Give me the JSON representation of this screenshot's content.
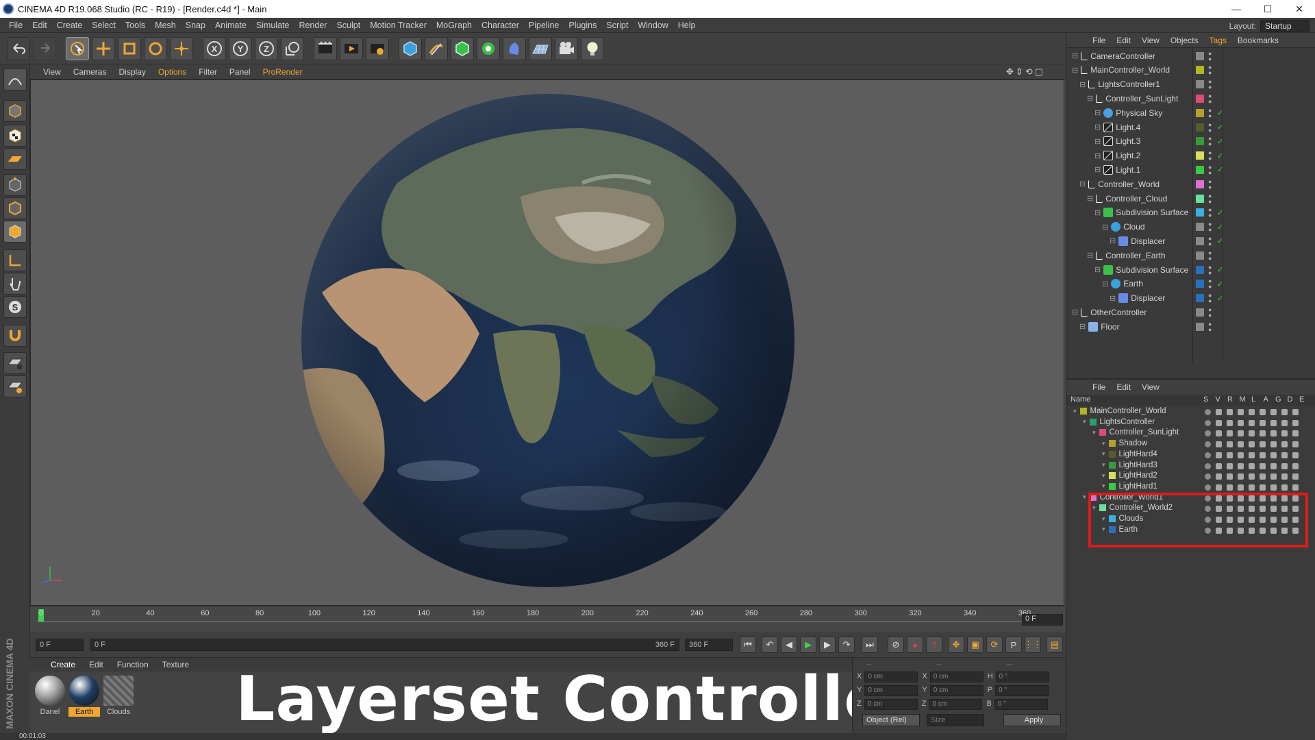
{
  "titlebar": {
    "title": "CINEMA 4D R19.068 Studio (RC - R19) - [Render.c4d *] - Main",
    "min": "—",
    "max": "☐",
    "close": "✕"
  },
  "menubar": {
    "items": [
      "File",
      "Edit",
      "Create",
      "Select",
      "Tools",
      "Mesh",
      "Snap",
      "Animate",
      "Simulate",
      "Render",
      "Sculpt",
      "Motion Tracker",
      "MoGraph",
      "Character",
      "Pipeline",
      "Plugins",
      "Script",
      "Window",
      "Help"
    ],
    "layout_label": "Layout:",
    "layout_value": "Startup"
  },
  "viewport_menu": {
    "items": [
      "View",
      "Cameras",
      "Display",
      "Options",
      "Filter",
      "Panel",
      "ProRender"
    ],
    "highlight": [
      "Options",
      "ProRender"
    ]
  },
  "timeline": {
    "ticks": [
      "0",
      "20",
      "40",
      "60",
      "80",
      "100",
      "120",
      "140",
      "160",
      "180",
      "200",
      "220",
      "240",
      "260",
      "280",
      "300",
      "320",
      "340",
      "360"
    ],
    "frame_field": "0 F"
  },
  "transport": {
    "start_field": "0 F",
    "slider_start": "0 F",
    "slider_end": "360 F",
    "end_field": "360 F"
  },
  "material_menu": {
    "items": [
      "Create",
      "Edit",
      "Function",
      "Texture"
    ],
    "highlight": "Create"
  },
  "materials": [
    {
      "name": "Danel",
      "active": false,
      "color": "#9a9a9a"
    },
    {
      "name": "Earth",
      "active": true,
      "color": "#1f3f66"
    },
    {
      "name": "Clouds",
      "active": false,
      "color": "#6e6e6e"
    }
  ],
  "headline": "Layerset Controller",
  "maxon": "MAXON CINEMA 4D",
  "coords": {
    "headers": [
      "--",
      "--",
      "--"
    ],
    "rows": [
      {
        "a": "X",
        "av": "0 cm",
        "b": "X",
        "bv": "0 cm",
        "c": "H",
        "cv": "0 °"
      },
      {
        "a": "Y",
        "av": "0 cm",
        "b": "Y",
        "bv": "0 cm",
        "c": "P",
        "cv": "0 °"
      },
      {
        "a": "Z",
        "av": "0 cm",
        "b": "Z",
        "bv": "0 cm",
        "c": "B",
        "cv": "0 °"
      }
    ],
    "mode": "Object (Rel)",
    "size": "Size",
    "apply": "Apply"
  },
  "status": "00:01:03",
  "object_manager": {
    "menu": [
      "File",
      "Edit",
      "View",
      "Objects",
      "Tags",
      "Bookmarks"
    ],
    "menu_highlight": "Tags",
    "rows": [
      {
        "name": "CameraController",
        "indent": 0,
        "icon": "null",
        "color": "#8a8a8a",
        "check": false
      },
      {
        "name": "MainController_World",
        "indent": 0,
        "icon": "null",
        "color": "#b5b522",
        "check": false
      },
      {
        "name": "LightsController1",
        "indent": 1,
        "icon": "null",
        "color": "#8a8a8a",
        "check": false
      },
      {
        "name": "Controller_SunLight",
        "indent": 2,
        "icon": "null",
        "color": "#e04a78",
        "check": false
      },
      {
        "name": "Physical Sky",
        "indent": 3,
        "icon": "sky",
        "color": "#b5a02a",
        "check": true
      },
      {
        "name": "Light.4",
        "indent": 3,
        "icon": "light",
        "color": "#5a5a2a",
        "check": true
      },
      {
        "name": "Light.3",
        "indent": 3,
        "icon": "light",
        "color": "#3a9a3a",
        "check": true
      },
      {
        "name": "Light.2",
        "indent": 3,
        "icon": "light",
        "color": "#d8e05a",
        "check": true
      },
      {
        "name": "Light.1",
        "indent": 3,
        "icon": "light",
        "color": "#3ac84a",
        "check": true
      },
      {
        "name": "Controller_World",
        "indent": 1,
        "icon": "null",
        "color": "#e070d0",
        "check": false
      },
      {
        "name": "Controller_Cloud",
        "indent": 2,
        "icon": "null",
        "color": "#6ae0a0",
        "check": false
      },
      {
        "name": "Subdivision Surface",
        "indent": 3,
        "icon": "subd",
        "color": "#3ab0e0",
        "check": true
      },
      {
        "name": "Cloud",
        "indent": 4,
        "icon": "sphere",
        "color": "#8a8a8a",
        "check": true
      },
      {
        "name": "Displacer",
        "indent": 5,
        "icon": "disp",
        "color": "#8a8a8a",
        "check": true
      },
      {
        "name": "Controller_Earth",
        "indent": 2,
        "icon": "null",
        "color": "#8a8a8a",
        "check": false
      },
      {
        "name": "Subdivision Surface",
        "indent": 3,
        "icon": "subd",
        "color": "#2a70c0",
        "check": true
      },
      {
        "name": "Earth",
        "indent": 4,
        "icon": "sphere",
        "color": "#2a70c0",
        "check": true
      },
      {
        "name": "Displacer",
        "indent": 5,
        "icon": "disp",
        "color": "#2a70c0",
        "check": true
      },
      {
        "name": "OtherController",
        "indent": 0,
        "icon": "null",
        "color": "#8a8a8a",
        "check": false
      },
      {
        "name": "Floor",
        "indent": 1,
        "icon": "floor",
        "color": "#8a8a8a",
        "check": false
      }
    ]
  },
  "layer_manager": {
    "menu": [
      "File",
      "Edit",
      "View"
    ],
    "headers": [
      "Name",
      "S",
      "V",
      "R",
      "M",
      "L",
      "A",
      "G",
      "D",
      "E"
    ],
    "rows": [
      {
        "name": "MainController_World",
        "indent": 0,
        "color": "#b5b522"
      },
      {
        "name": "LightsController",
        "indent": 1,
        "color": "#2aa070"
      },
      {
        "name": "Controller_SunLight",
        "indent": 2,
        "color": "#e04a78"
      },
      {
        "name": "Shadow",
        "indent": 3,
        "color": "#b5a02a"
      },
      {
        "name": "LightHard4",
        "indent": 3,
        "color": "#5a5a2a"
      },
      {
        "name": "LightHard3",
        "indent": 3,
        "color": "#3a9a3a"
      },
      {
        "name": "LightHard2",
        "indent": 3,
        "color": "#d8e05a"
      },
      {
        "name": "LightHard1",
        "indent": 3,
        "color": "#3ac84a"
      },
      {
        "name": "Controller_World1",
        "indent": 1,
        "color": "#e070d0"
      },
      {
        "name": "Controller_World2",
        "indent": 2,
        "color": "#6ae0a0"
      },
      {
        "name": "Clouds",
        "indent": 3,
        "color": "#3ab0e0"
      },
      {
        "name": "Earth",
        "indent": 3,
        "color": "#2a70c0"
      }
    ]
  }
}
